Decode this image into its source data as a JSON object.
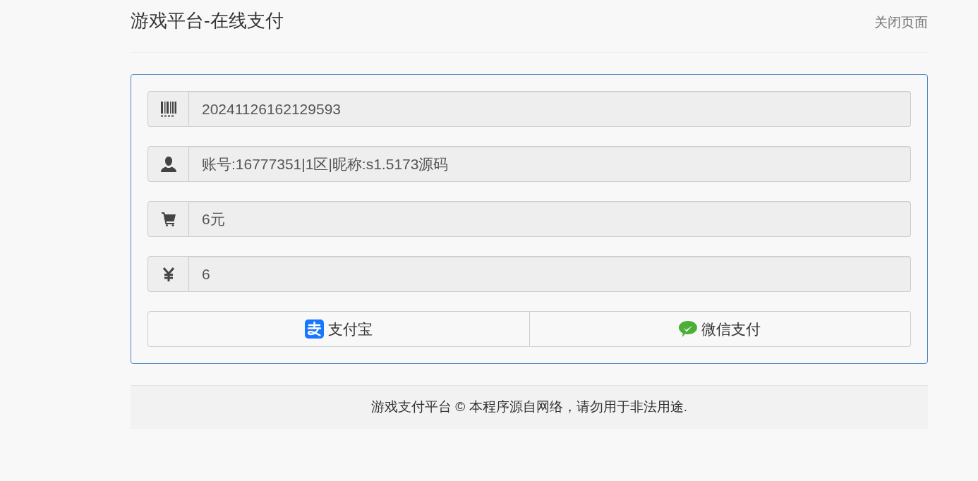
{
  "header": {
    "title": "游戏平台-在线支付",
    "close_link": "关闭页面"
  },
  "fields": [
    {
      "kind": "order",
      "value": "20241126162129593"
    },
    {
      "kind": "account",
      "value": "账号:16777351|1区|昵称:s1.5173源码"
    },
    {
      "kind": "product",
      "value": "6元"
    },
    {
      "kind": "amount",
      "value": "6"
    }
  ],
  "pay_buttons": [
    {
      "kind": "alipay",
      "label": "支付宝"
    },
    {
      "kind": "wechat",
      "label": "微信支付"
    }
  ],
  "footer": "游戏支付平台 © 本程序源自网络，请勿用于非法用途."
}
